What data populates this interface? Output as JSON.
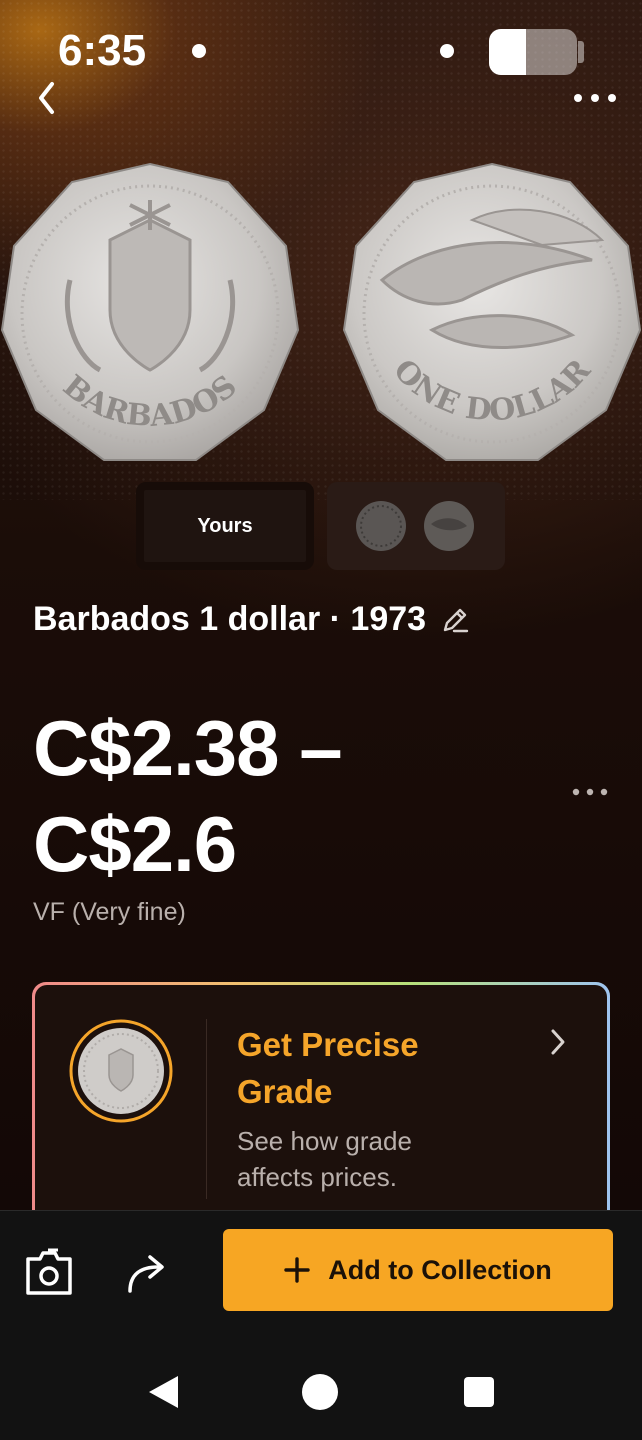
{
  "status_bar": {
    "time": "6:35",
    "battery_level": 0.42
  },
  "header": {
    "back_icon": "chevron-left-icon",
    "more_icon": "more-horizontal-icon"
  },
  "coin_images": {
    "obverse_text": "BARBADOS",
    "reverse_text": "ONE DOLLAR"
  },
  "image_selector": {
    "yours_label": "Yours"
  },
  "coin": {
    "title": "Barbados 1 dollar · 1973",
    "edit_icon": "pencil-icon"
  },
  "price": {
    "range": "C$2.38 – C$2.6",
    "grade": "VF (Very fine)"
  },
  "precise_grade_card": {
    "title": "Get Precise Grade",
    "subtitle": "See how grade affects prices.",
    "accent_color": "#f5a52a"
  },
  "action_bar": {
    "camera_icon": "camera-icon",
    "share_icon": "share-icon",
    "add_label": "Add to Collection",
    "add_color": "#f7a623"
  },
  "system_nav": {
    "back_icon": "nav-back-icon",
    "home_icon": "nav-home-icon",
    "recents_icon": "nav-recents-icon"
  }
}
